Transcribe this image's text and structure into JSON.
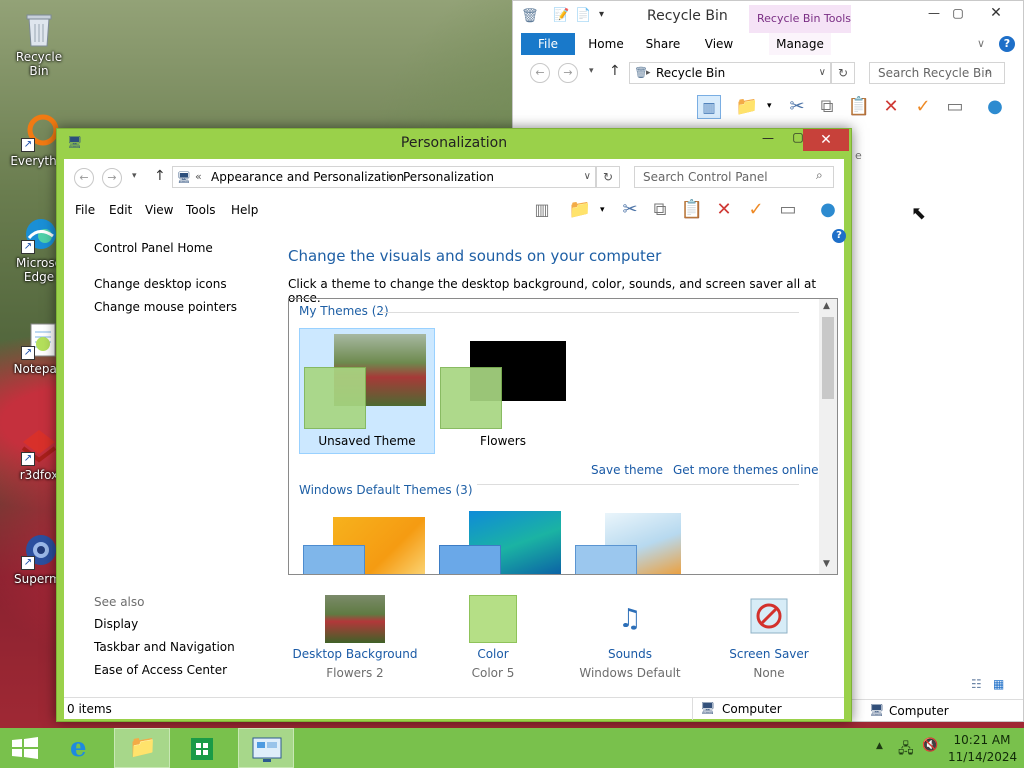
{
  "desktop": {
    "icons": [
      {
        "label": "Recycle Bin",
        "icon": "recycle-bin-icon"
      },
      {
        "label": "Everythin",
        "icon": "everything-search-icon"
      },
      {
        "label": "Microso Edge",
        "icon": "edge-icon"
      },
      {
        "label": "Notepad",
        "icon": "notepad-icon"
      },
      {
        "label": "r3dfox",
        "icon": "r3dfox-icon"
      },
      {
        "label": "Supermi",
        "icon": "supermium-icon"
      }
    ]
  },
  "recycle_bin": {
    "title": "Recycle Bin",
    "context_tab": "Recycle Bin Tools",
    "tabs": [
      "File",
      "Home",
      "Share",
      "View",
      "Manage"
    ],
    "address": "Recycle Bin",
    "search_placeholder": "Search Recycle Bin",
    "status_right": "Computer",
    "cut_text": "e",
    "colors": {
      "file_tab": "#1979ca",
      "context_tab_bg": "#f5e3f6"
    }
  },
  "personalization": {
    "title": "Personalization",
    "breadcrumb": {
      "chevron": "«",
      "parent": "Appearance and Personalization",
      "current": "Personalization"
    },
    "search_placeholder": "Search Control Panel",
    "menu": [
      "File",
      "Edit",
      "View",
      "Tools",
      "Help"
    ],
    "left_links": [
      "Control Panel Home",
      "Change desktop icons",
      "Change mouse pointers"
    ],
    "see_also": {
      "heading": "See also",
      "links": [
        "Display",
        "Taskbar and Navigation",
        "Ease of Access Center"
      ]
    },
    "main": {
      "heading": "Change the visuals and sounds on your computer",
      "subtext": "Click a theme to change the desktop background, color, sounds, and screen saver all at once.",
      "my_themes_header": "My Themes (2)",
      "themes": [
        {
          "label": "Unsaved Theme",
          "selected": true
        },
        {
          "label": "Flowers",
          "selected": false
        }
      ],
      "save_theme": "Save theme",
      "more_themes": "Get more themes online",
      "default_themes_header": "Windows Default Themes (3)"
    },
    "bottom": [
      {
        "label": "Desktop Background",
        "value": "Flowers 2",
        "icon": "flowers-thumbnail-icon"
      },
      {
        "label": "Color",
        "value": "Color 5",
        "icon": "color-swatch-icon"
      },
      {
        "label": "Sounds",
        "value": "Windows Default",
        "icon": "sounds-piano-icon"
      },
      {
        "label": "Screen Saver",
        "value": "None",
        "icon": "screen-saver-icon"
      }
    ],
    "status_items": "0 items",
    "status_right": "Computer",
    "colors": {
      "frame": "#9ad14a",
      "close": "#c7413a",
      "link": "#1a5aa6",
      "heading": "#1e5fa5"
    }
  },
  "taskbar": {
    "time": "10:21 AM",
    "date": "11/14/2024",
    "buttons": [
      "start-icon",
      "internet-explorer-icon",
      "file-explorer-icon",
      "store-icon",
      "control-panel-icon"
    ],
    "color": "#79c14c"
  }
}
